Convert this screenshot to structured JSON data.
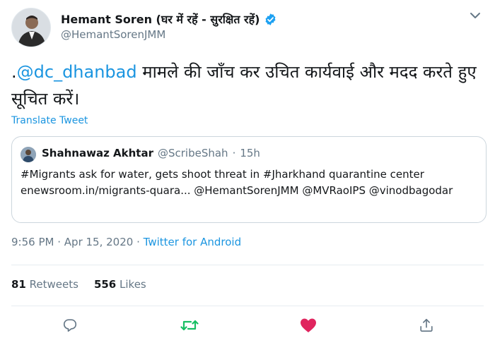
{
  "author": {
    "display_name": "Hemant Soren (घर में रहें - सुरक्षित रहें)",
    "handle": "@HemantSorenJMM",
    "verified": true
  },
  "tweet": {
    "prefix": ".",
    "mention": "@dc_dhanbad",
    "text": " मामले की जाँच कर उचित कार्यवाई और मदद करते हुए सूचित करें।",
    "translate_label": "Translate Tweet"
  },
  "quoted_tweet": {
    "display_name": "Shahnawaz Akhtar",
    "handle": "@ScribeShah",
    "separator": "·",
    "time": "15h",
    "body": "#Migrants ask for water, gets shoot threat in #Jharkhand quarantine center enewsroom.in/migrants-quara... @HemantSorenJMM @MVRaoIPS @vinodbagodar"
  },
  "meta": {
    "time": "9:56 PM",
    "date": "Apr 15, 2020",
    "separator": "·",
    "source": "Twitter for Android"
  },
  "stats": {
    "retweets_count": "81",
    "retweets_label": "Retweets",
    "likes_count": "556",
    "likes_label": "Likes"
  },
  "icons": {
    "reply": "reply-icon",
    "retweet": "retweet-icon",
    "like": "heart-icon",
    "share": "share-icon",
    "more": "chevron-down-icon",
    "verified": "verified-badge-icon"
  },
  "colors": {
    "accent": "#1b95e0",
    "retweet": "#17bf63",
    "like": "#e0245e",
    "muted": "#657786"
  }
}
